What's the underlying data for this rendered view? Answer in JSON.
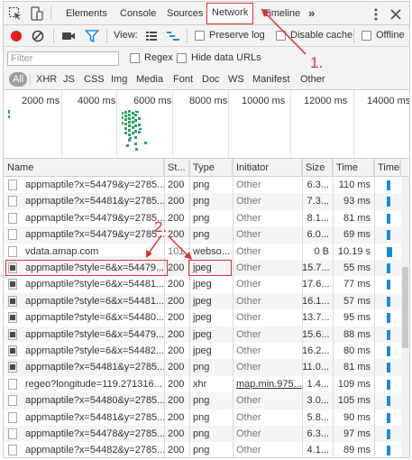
{
  "tabs": [
    "Elements",
    "Console",
    "Sources",
    "Network",
    "Timeline"
  ],
  "active_tab": "Network",
  "more_tabs_glyph": "»",
  "toolbar": {
    "view_label": "View:",
    "preserve_log": "Preserve log",
    "disable_cache": "Disable cache",
    "offline": "Offline"
  },
  "filter": {
    "placeholder": "Filter",
    "regex": "Regex",
    "hide_data_urls": "Hide data URLs"
  },
  "types": [
    "All",
    "XHR",
    "JS",
    "CSS",
    "Img",
    "Media",
    "Font",
    "Doc",
    "WS",
    "Manifest",
    "Other"
  ],
  "active_type": "All",
  "overview_ticks": [
    "2000 ms",
    "4000 ms",
    "6000 ms",
    "8000 ms",
    "10000 ms",
    "12000 ms",
    "14000 ms"
  ],
  "columns": [
    "Name",
    "St...",
    "Type",
    "Initiator",
    "Size",
    "Time",
    "Timeli"
  ],
  "rows": [
    {
      "name": "appmaptile?x=54479&y=2785...",
      "status": "200",
      "type": "png",
      "initiator": "Other",
      "size": "6.3...",
      "time": "110 ms",
      "icon": "file",
      "bar": 4
    },
    {
      "name": "appmaptile?x=54481&y=2785...",
      "status": "200",
      "type": "png",
      "initiator": "Other",
      "size": "7.3...",
      "time": "93 ms",
      "icon": "file",
      "bar": 4
    },
    {
      "name": "appmaptile?x=54479&y=2785...",
      "status": "200",
      "type": "png",
      "initiator": "Other",
      "size": "8.1...",
      "time": "81 ms",
      "icon": "file",
      "bar": 4
    },
    {
      "name": "appmaptile?x=54479&y=2785...",
      "status": "200",
      "type": "png",
      "initiator": "Other",
      "size": "6.0...",
      "time": "69 ms",
      "icon": "file",
      "bar": 4
    },
    {
      "name": "vdata.amap.com",
      "status": "101",
      "type": "webso...",
      "initiator": "Other",
      "size": "0 B",
      "time": "10.19 s",
      "icon": "file",
      "bar": 6
    },
    {
      "name": "appmaptile?style=6&x=54479...",
      "status": "200",
      "type": "jpeg",
      "initiator": "Other",
      "size": "15.7...",
      "time": "55 ms",
      "icon": "img",
      "bar": 4
    },
    {
      "name": "appmaptile?style=6&x=54481...",
      "status": "200",
      "type": "jpeg",
      "initiator": "Other",
      "size": "17.6...",
      "time": "77 ms",
      "icon": "img",
      "bar": 4
    },
    {
      "name": "appmaptile?style=6&x=54481...",
      "status": "200",
      "type": "jpeg",
      "initiator": "Other",
      "size": "16.1...",
      "time": "57 ms",
      "icon": "img",
      "bar": 4
    },
    {
      "name": "appmaptile?style=6&x=54480...",
      "status": "200",
      "type": "jpeg",
      "initiator": "Other",
      "size": "13.7...",
      "time": "95 ms",
      "icon": "img",
      "bar": 4
    },
    {
      "name": "appmaptile?style=6&x=54479...",
      "status": "200",
      "type": "jpeg",
      "initiator": "Other",
      "size": "15.6...",
      "time": "88 ms",
      "icon": "img",
      "bar": 4
    },
    {
      "name": "appmaptile?style=6&x=54482...",
      "status": "200",
      "type": "jpeg",
      "initiator": "Other",
      "size": "16.2...",
      "time": "80 ms",
      "icon": "img",
      "bar": 4
    },
    {
      "name": "appmaptile?x=54481&y=2785...",
      "status": "200",
      "type": "png",
      "initiator": "Other",
      "size": "11.0...",
      "time": "81 ms",
      "icon": "img",
      "bar": 4
    },
    {
      "name": "regeo?longitude=119.271316...",
      "status": "200",
      "type": "xhr",
      "initiator": "map.min.975...",
      "size": "1.4...",
      "time": "109 ms",
      "icon": "file",
      "bar": 4
    },
    {
      "name": "appmaptile?x=54480&y=2785...",
      "status": "200",
      "type": "png",
      "initiator": "Other",
      "size": "3.0...",
      "time": "105 ms",
      "icon": "file",
      "bar": 4
    },
    {
      "name": "appmaptile?x=54481&y=2785...",
      "status": "200",
      "type": "png",
      "initiator": "Other",
      "size": "5.8...",
      "time": "90 ms",
      "icon": "file",
      "bar": 4
    },
    {
      "name": "appmaptile?x=54478&y=2785...",
      "status": "200",
      "type": "png",
      "initiator": "Other",
      "size": "6.3...",
      "time": "97 ms",
      "icon": "file",
      "bar": 4
    },
    {
      "name": "appmaptile?x=54482&y=2785...",
      "status": "200",
      "type": "png",
      "initiator": "Other",
      "size": "4.1...",
      "time": "89 ms",
      "icon": "file",
      "bar": 4
    }
  ],
  "annotations": {
    "label_1": "1.",
    "label_2": "2."
  },
  "colors": {
    "record": "#e02020",
    "accent": "#1a8be0",
    "annotation": "#e03030"
  }
}
